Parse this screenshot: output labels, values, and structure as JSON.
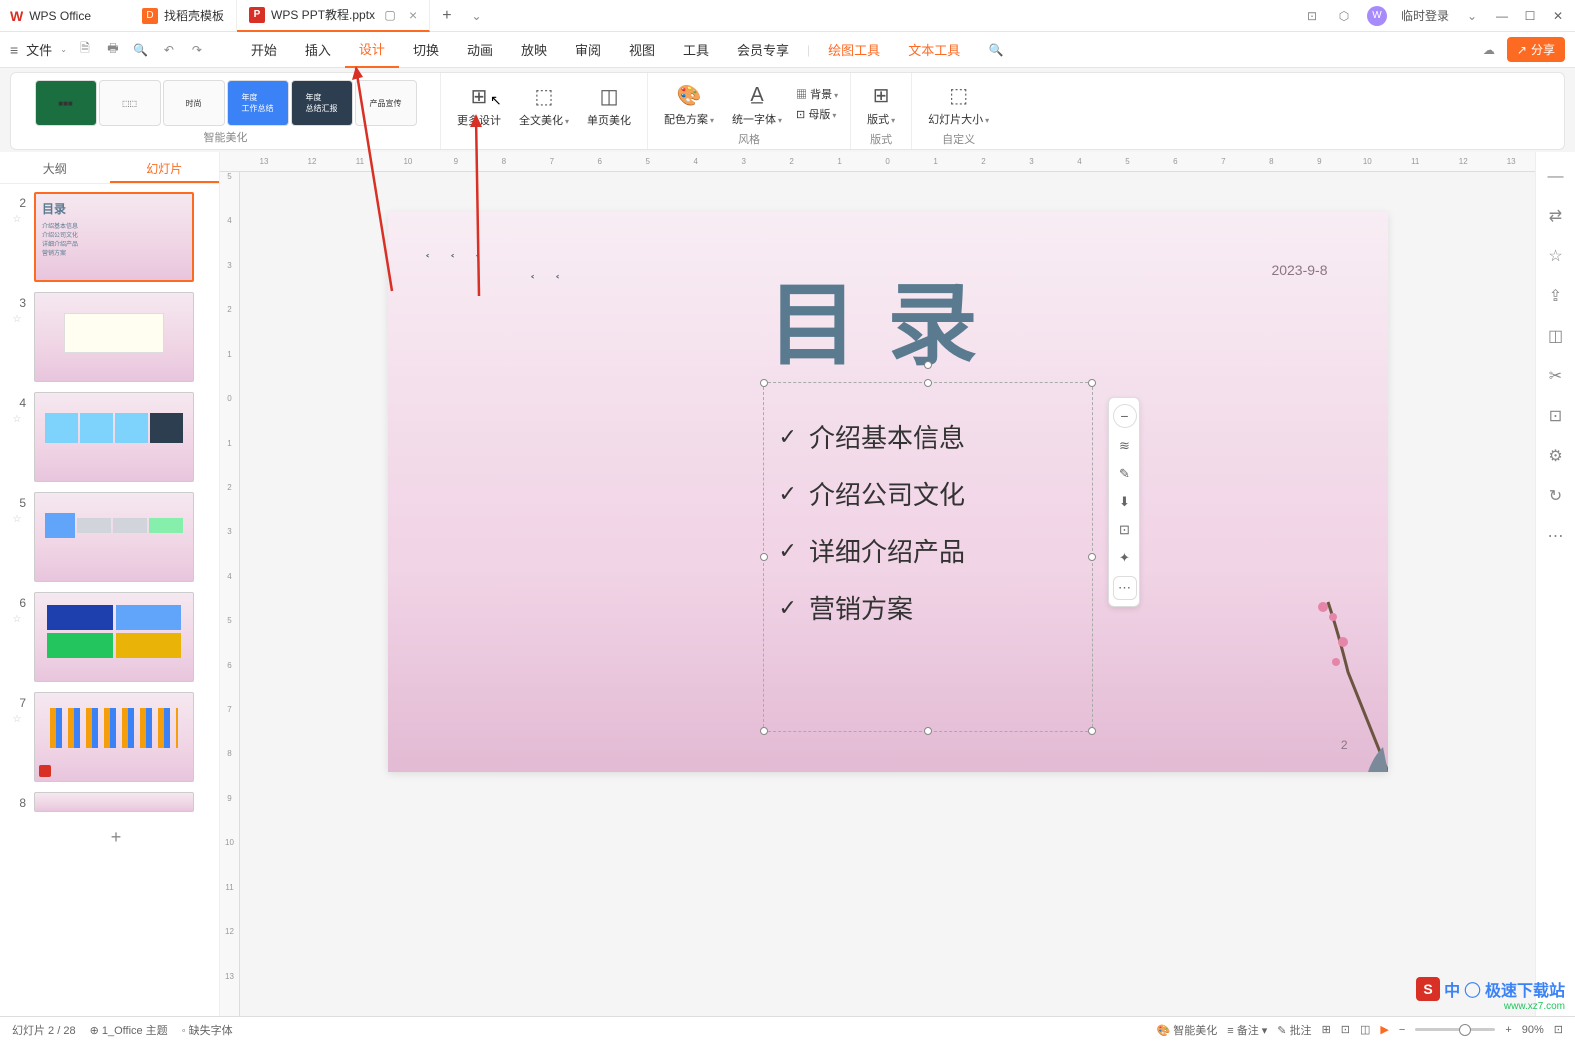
{
  "tabs": {
    "wps_office": "WPS Office",
    "template_tab": "找稻壳模板",
    "doc_tab": "WPS PPT教程.pptx"
  },
  "header": {
    "login": "临时登录"
  },
  "file_menu": "文件",
  "menu_tabs": [
    "开始",
    "插入",
    "设计",
    "切换",
    "动画",
    "放映",
    "审阅",
    "视图",
    "工具",
    "会员专享"
  ],
  "context_tabs": [
    "绘图工具",
    "文本工具"
  ],
  "share_label": "分享",
  "ribbon": {
    "smart_beautify": "智能美化",
    "more_design": "更多设计",
    "full_beautify": "全文美化",
    "single_beautify": "单页美化",
    "color_scheme": "配色方案",
    "unify_font": "统一字体",
    "background": "背景",
    "master": "母版",
    "style_group": "风格",
    "layout": "版式",
    "layout_group": "版式",
    "slide_size": "幻灯片大小",
    "custom_group": "自定义"
  },
  "sidebar": {
    "outline": "大纲",
    "slides": "幻灯片",
    "slide_nums": [
      "2",
      "3",
      "4",
      "5",
      "6",
      "7",
      "8"
    ]
  },
  "slide": {
    "title": "目录",
    "date": "2023-9-8",
    "page_num": "2",
    "items": [
      "介绍基本信息",
      "介绍公司文化",
      "详细介绍产品",
      "营销方案"
    ]
  },
  "thumb_title": "目录",
  "thumb_items": [
    "介绍基本信息",
    "介绍公司文化",
    "详细介绍产品",
    "营销方案"
  ],
  "status": {
    "slide_info": "幻灯片 2 / 28",
    "theme": "1_Office 主题",
    "missing_font": "缺失字体",
    "smart_beautify": "智能美化",
    "notes": "备注",
    "comments": "批注",
    "zoom": "90%"
  },
  "watermark": {
    "top": "中 ◯ 极速下载站",
    "bottom": "www.xz7.com"
  }
}
